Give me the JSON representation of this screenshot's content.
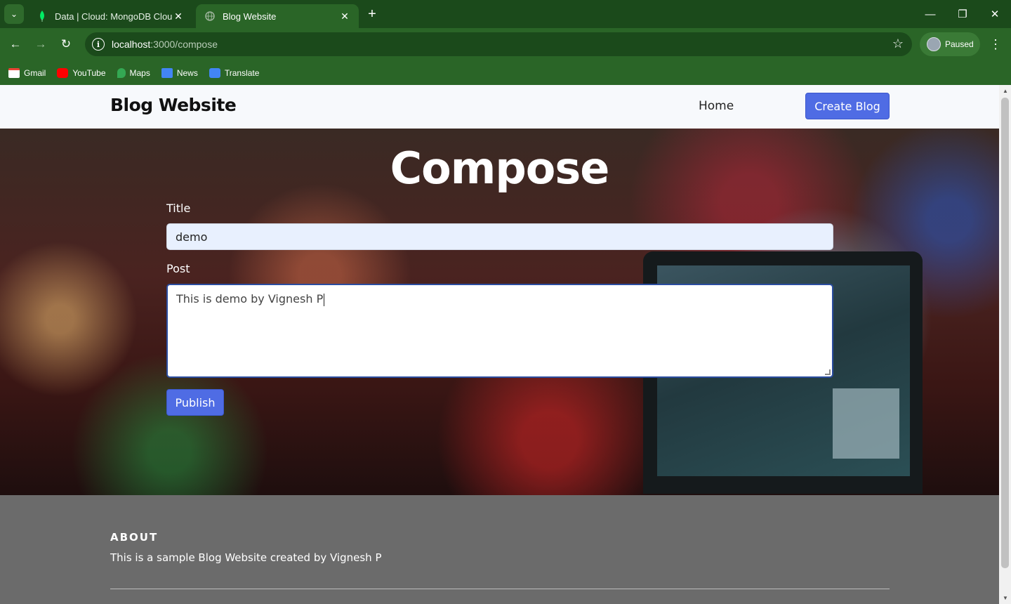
{
  "browser": {
    "tabs": [
      {
        "title": "Data | Cloud: MongoDB Cloud",
        "icon": "mongodb-leaf-icon",
        "active": false
      },
      {
        "title": "Blog Website",
        "icon": "globe-icon",
        "active": true
      }
    ],
    "url_host": "localhost",
    "url_path": ":3000/compose",
    "profile_label": "Paused",
    "bookmarks": [
      {
        "label": "Gmail",
        "icon": "gmail-icon",
        "color": "#ea4335"
      },
      {
        "label": "YouTube",
        "icon": "youtube-icon",
        "color": "#ff0000"
      },
      {
        "label": "Maps",
        "icon": "maps-icon",
        "color": "#34a853"
      },
      {
        "label": "News",
        "icon": "news-icon",
        "color": "#4285f4"
      },
      {
        "label": "Translate",
        "icon": "translate-icon",
        "color": "#4285f4"
      }
    ],
    "chrome_color": "#2a6527"
  },
  "site": {
    "brand": "Blog Website",
    "nav_home": "Home",
    "create_button": "Create Blog",
    "accent": "#4f6ce4"
  },
  "compose": {
    "heading": "Compose",
    "title_label": "Title",
    "title_value": "demo",
    "post_label": "Post",
    "post_value": "This is demo by Vignesh P",
    "publish_button": "Publish"
  },
  "footer": {
    "about_heading": "ABOUT",
    "about_text": "This is a sample Blog Website created by Vignesh P"
  }
}
